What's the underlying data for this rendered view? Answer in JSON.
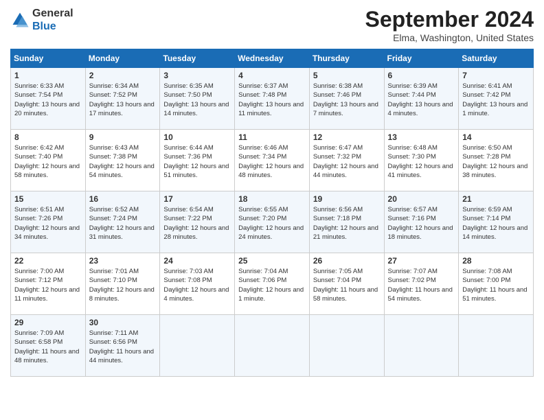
{
  "header": {
    "logo_general": "General",
    "logo_blue": "Blue",
    "title": "September 2024",
    "location": "Elma, Washington, United States"
  },
  "days_of_week": [
    "Sunday",
    "Monday",
    "Tuesday",
    "Wednesday",
    "Thursday",
    "Friday",
    "Saturday"
  ],
  "weeks": [
    [
      {
        "day": "1",
        "sunrise": "6:33 AM",
        "sunset": "7:54 PM",
        "daylight": "13 hours and 20 minutes."
      },
      {
        "day": "2",
        "sunrise": "6:34 AM",
        "sunset": "7:52 PM",
        "daylight": "13 hours and 17 minutes."
      },
      {
        "day": "3",
        "sunrise": "6:35 AM",
        "sunset": "7:50 PM",
        "daylight": "13 hours and 14 minutes."
      },
      {
        "day": "4",
        "sunrise": "6:37 AM",
        "sunset": "7:48 PM",
        "daylight": "13 hours and 11 minutes."
      },
      {
        "day": "5",
        "sunrise": "6:38 AM",
        "sunset": "7:46 PM",
        "daylight": "13 hours and 7 minutes."
      },
      {
        "day": "6",
        "sunrise": "6:39 AM",
        "sunset": "7:44 PM",
        "daylight": "13 hours and 4 minutes."
      },
      {
        "day": "7",
        "sunrise": "6:41 AM",
        "sunset": "7:42 PM",
        "daylight": "13 hours and 1 minute."
      }
    ],
    [
      {
        "day": "8",
        "sunrise": "6:42 AM",
        "sunset": "7:40 PM",
        "daylight": "12 hours and 58 minutes."
      },
      {
        "day": "9",
        "sunrise": "6:43 AM",
        "sunset": "7:38 PM",
        "daylight": "12 hours and 54 minutes."
      },
      {
        "day": "10",
        "sunrise": "6:44 AM",
        "sunset": "7:36 PM",
        "daylight": "12 hours and 51 minutes."
      },
      {
        "day": "11",
        "sunrise": "6:46 AM",
        "sunset": "7:34 PM",
        "daylight": "12 hours and 48 minutes."
      },
      {
        "day": "12",
        "sunrise": "6:47 AM",
        "sunset": "7:32 PM",
        "daylight": "12 hours and 44 minutes."
      },
      {
        "day": "13",
        "sunrise": "6:48 AM",
        "sunset": "7:30 PM",
        "daylight": "12 hours and 41 minutes."
      },
      {
        "day": "14",
        "sunrise": "6:50 AM",
        "sunset": "7:28 PM",
        "daylight": "12 hours and 38 minutes."
      }
    ],
    [
      {
        "day": "15",
        "sunrise": "6:51 AM",
        "sunset": "7:26 PM",
        "daylight": "12 hours and 34 minutes."
      },
      {
        "day": "16",
        "sunrise": "6:52 AM",
        "sunset": "7:24 PM",
        "daylight": "12 hours and 31 minutes."
      },
      {
        "day": "17",
        "sunrise": "6:54 AM",
        "sunset": "7:22 PM",
        "daylight": "12 hours and 28 minutes."
      },
      {
        "day": "18",
        "sunrise": "6:55 AM",
        "sunset": "7:20 PM",
        "daylight": "12 hours and 24 minutes."
      },
      {
        "day": "19",
        "sunrise": "6:56 AM",
        "sunset": "7:18 PM",
        "daylight": "12 hours and 21 minutes."
      },
      {
        "day": "20",
        "sunrise": "6:57 AM",
        "sunset": "7:16 PM",
        "daylight": "12 hours and 18 minutes."
      },
      {
        "day": "21",
        "sunrise": "6:59 AM",
        "sunset": "7:14 PM",
        "daylight": "12 hours and 14 minutes."
      }
    ],
    [
      {
        "day": "22",
        "sunrise": "7:00 AM",
        "sunset": "7:12 PM",
        "daylight": "12 hours and 11 minutes."
      },
      {
        "day": "23",
        "sunrise": "7:01 AM",
        "sunset": "7:10 PM",
        "daylight": "12 hours and 8 minutes."
      },
      {
        "day": "24",
        "sunrise": "7:03 AM",
        "sunset": "7:08 PM",
        "daylight": "12 hours and 4 minutes."
      },
      {
        "day": "25",
        "sunrise": "7:04 AM",
        "sunset": "7:06 PM",
        "daylight": "12 hours and 1 minute."
      },
      {
        "day": "26",
        "sunrise": "7:05 AM",
        "sunset": "7:04 PM",
        "daylight": "11 hours and 58 minutes."
      },
      {
        "day": "27",
        "sunrise": "7:07 AM",
        "sunset": "7:02 PM",
        "daylight": "11 hours and 54 minutes."
      },
      {
        "day": "28",
        "sunrise": "7:08 AM",
        "sunset": "7:00 PM",
        "daylight": "11 hours and 51 minutes."
      }
    ],
    [
      {
        "day": "29",
        "sunrise": "7:09 AM",
        "sunset": "6:58 PM",
        "daylight": "11 hours and 48 minutes."
      },
      {
        "day": "30",
        "sunrise": "7:11 AM",
        "sunset": "6:56 PM",
        "daylight": "11 hours and 44 minutes."
      },
      {
        "day": "",
        "sunrise": "",
        "sunset": "",
        "daylight": ""
      },
      {
        "day": "",
        "sunrise": "",
        "sunset": "",
        "daylight": ""
      },
      {
        "day": "",
        "sunrise": "",
        "sunset": "",
        "daylight": ""
      },
      {
        "day": "",
        "sunrise": "",
        "sunset": "",
        "daylight": ""
      },
      {
        "day": "",
        "sunrise": "",
        "sunset": "",
        "daylight": ""
      }
    ]
  ]
}
